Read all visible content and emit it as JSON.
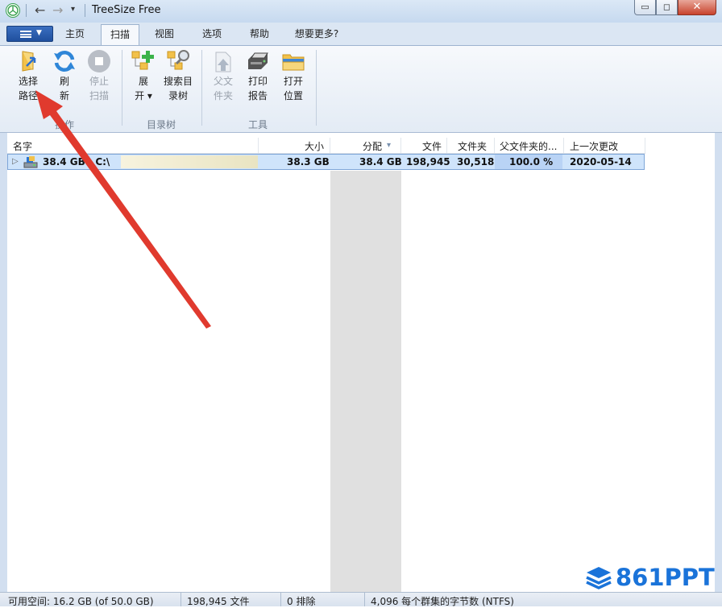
{
  "window": {
    "title": "TreeSize Free",
    "minimize": "▭",
    "maximize": "◻",
    "close": "✕"
  },
  "ribbon_tabs": [
    "主页",
    "扫描",
    "视图",
    "选项",
    "帮助",
    "想要更多?"
  ],
  "active_tab": "扫描",
  "ribbon": {
    "select_path": [
      "选择",
      "路径"
    ],
    "refresh": [
      "刷",
      "新"
    ],
    "stop_scan": [
      "停止",
      "扫描"
    ],
    "expand": [
      "展",
      "开 ▾"
    ],
    "search_tree": [
      "搜索目",
      "录树"
    ],
    "parent_folder": [
      "父文",
      "件夹"
    ],
    "print_report": [
      "打印",
      "报告"
    ],
    "open_location": [
      "打开",
      "位置"
    ],
    "groups": {
      "operations": "操作",
      "tree": "目录树",
      "tools": "工具"
    }
  },
  "table": {
    "columns": [
      "名字",
      "大小",
      "分配",
      "文件",
      "文件夹",
      "父文件夹的...",
      "上一次更改"
    ],
    "sort_indicator": "▾",
    "rows": [
      {
        "expander": "▷",
        "name": "38.4 GB   C:\\",
        "size": "38.3 GB",
        "allocated": "38.4 GB",
        "files": "198,945",
        "folders": "30,518",
        "percent_parent": "100.0 %",
        "last_modified": "2020-05-14"
      }
    ]
  },
  "statusbar": {
    "free_space": "可用空间: 16.2 GB  (of 50.0 GB)",
    "files": "198,945 文件",
    "excluded": "0 排除",
    "cluster": "4,096 每个群集的字节数 (NTFS)"
  },
  "watermark": "861PPT",
  "colors": {
    "accent": "#1f4f9e",
    "selection": "#cfe4fb",
    "annotation_arrow": "#e03a2e",
    "watermark": "#1a73d9"
  }
}
